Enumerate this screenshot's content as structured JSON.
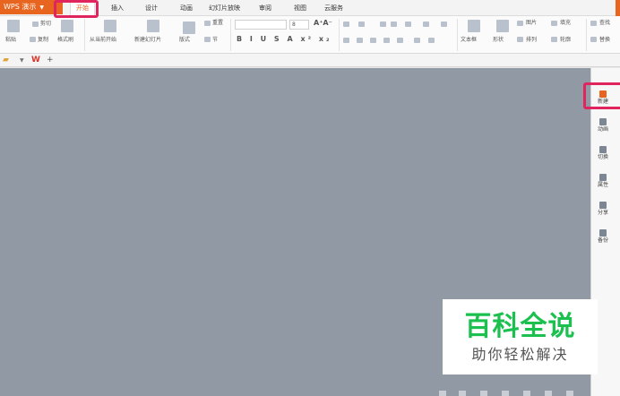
{
  "app_menu": {
    "label": "WPS 演示"
  },
  "tabs": [
    "开始",
    "插入",
    "设计",
    "动画",
    "幻灯片放映",
    "审阅",
    "视图",
    "云服务"
  ],
  "ribbon": {
    "paste": "粘贴",
    "cut": "剪切",
    "copy": "复制",
    "format_painter": "格式刷",
    "play_from_current": "从当前开始",
    "new_slide": "新建幻灯片",
    "layout": "版式",
    "reset": "重置",
    "section": "节",
    "font_size": "8",
    "text_box": "文本框",
    "shape": "形状",
    "picture": "图片",
    "arrange": "排列",
    "fill": "填充",
    "outline": "轮廓",
    "find": "查找",
    "replace": "替换"
  },
  "file_tabs": {
    "new_tab": "+"
  },
  "task_pane": [
    {
      "label": "新建",
      "icon": "new-icon"
    },
    {
      "label": "动画",
      "icon": "animation-icon"
    },
    {
      "label": "切换",
      "icon": "transition-icon"
    },
    {
      "label": "属性",
      "icon": "properties-icon"
    },
    {
      "label": "分享",
      "icon": "share-icon"
    },
    {
      "label": "备份",
      "icon": "backup-icon"
    }
  ],
  "watermark": {
    "title": "百科全说",
    "subtitle": "助你轻松解决"
  },
  "colors": {
    "accent": "#e8651f",
    "highlight": "#e0245e",
    "workspace": "#9199a4",
    "watermark_green": "#1bc04f"
  }
}
